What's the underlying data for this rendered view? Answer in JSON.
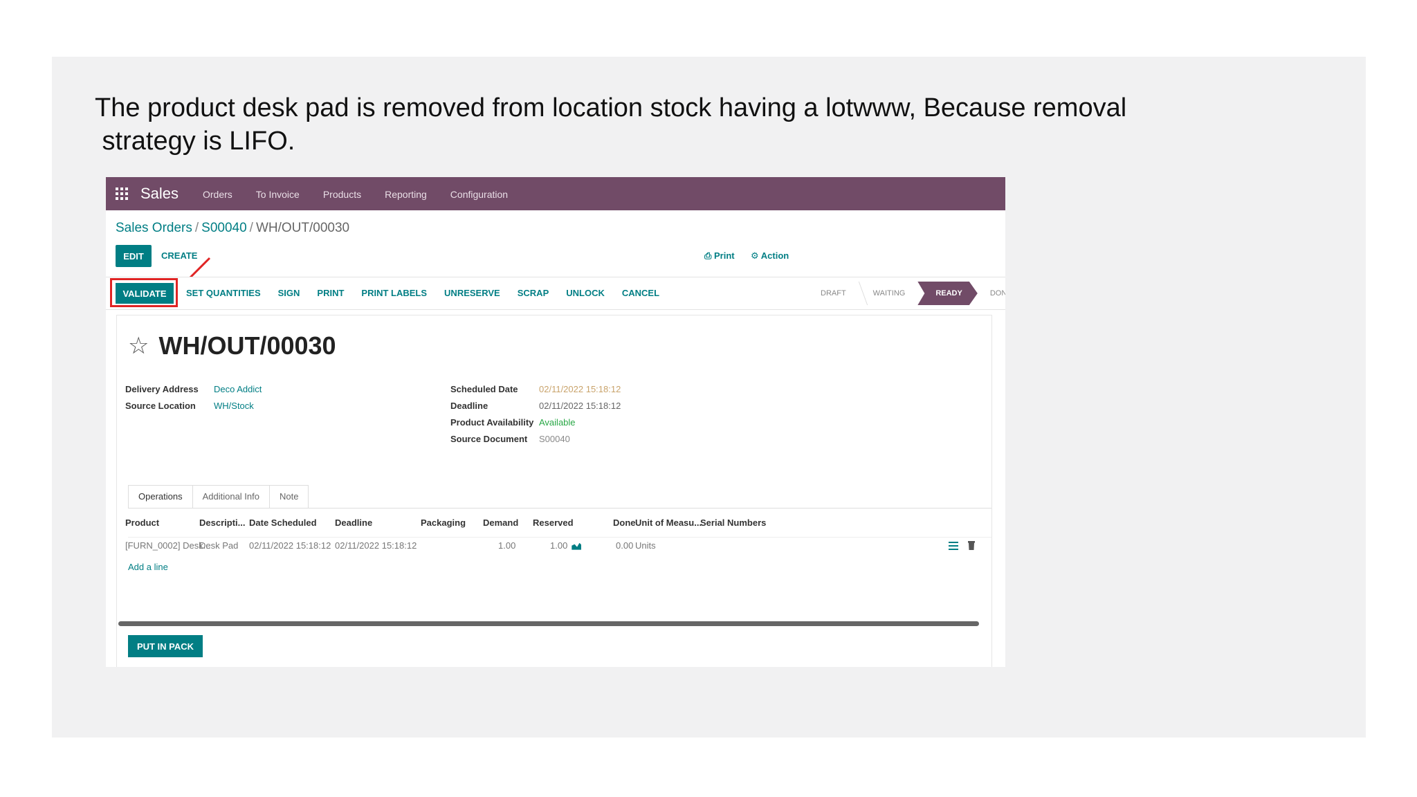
{
  "caption": {
    "line1": "The product desk pad is removed from location stock having a lotwww, Because removal",
    "line2": " strategy is LIFO."
  },
  "navbar": {
    "app": "Sales",
    "menu": [
      "Orders",
      "To Invoice",
      "Products",
      "Reporting",
      "Configuration"
    ]
  },
  "breadcrumb": {
    "a": "Sales Orders",
    "b": "S00040",
    "current": "WH/OUT/00030"
  },
  "control": {
    "edit": "EDIT",
    "create": "CREATE",
    "print": "Print",
    "action": "Action"
  },
  "statusbar": {
    "validate": "VALIDATE",
    "actions": [
      "SET QUANTITIES",
      "SIGN",
      "PRINT",
      "PRINT LABELS",
      "UNRESERVE",
      "SCRAP",
      "UNLOCK",
      "CANCEL"
    ],
    "stages": [
      "DRAFT",
      "WAITING",
      "READY",
      "DONE"
    ],
    "active_stage": "READY"
  },
  "record": {
    "title": "WH/OUT/00030",
    "delivery_address_label": "Delivery Address",
    "delivery_address": "Deco Addict",
    "source_location_label": "Source Location",
    "source_location": "WH/Stock",
    "scheduled_date_label": "Scheduled Date",
    "scheduled_date": "02/11/2022 15:18:12",
    "deadline_label": "Deadline",
    "deadline": "02/11/2022 15:18:12",
    "availability_label": "Product Availability",
    "availability": "Available",
    "source_doc_label": "Source Document",
    "source_doc": "S00040"
  },
  "tabs": [
    "Operations",
    "Additional Info",
    "Note"
  ],
  "table": {
    "headers": [
      "Product",
      "Descripti...",
      "Date Scheduled",
      "Deadline",
      "Packaging",
      "Demand",
      "Reserved",
      "Done",
      "Unit of Measu...",
      "Serial Numbers"
    ],
    "row": [
      "[FURN_0002] Desk...",
      "Desk Pad",
      "02/11/2022 15:18:12",
      "02/11/2022 15:18:12",
      "",
      "1.00",
      "1.00",
      "0.00",
      "Units",
      ""
    ],
    "add_line": "Add a line"
  },
  "footer": {
    "put_in_pack": "PUT IN PACK"
  },
  "colors": {
    "brand": "#714b67",
    "accent": "#017e84",
    "highlight": "#e02424"
  }
}
